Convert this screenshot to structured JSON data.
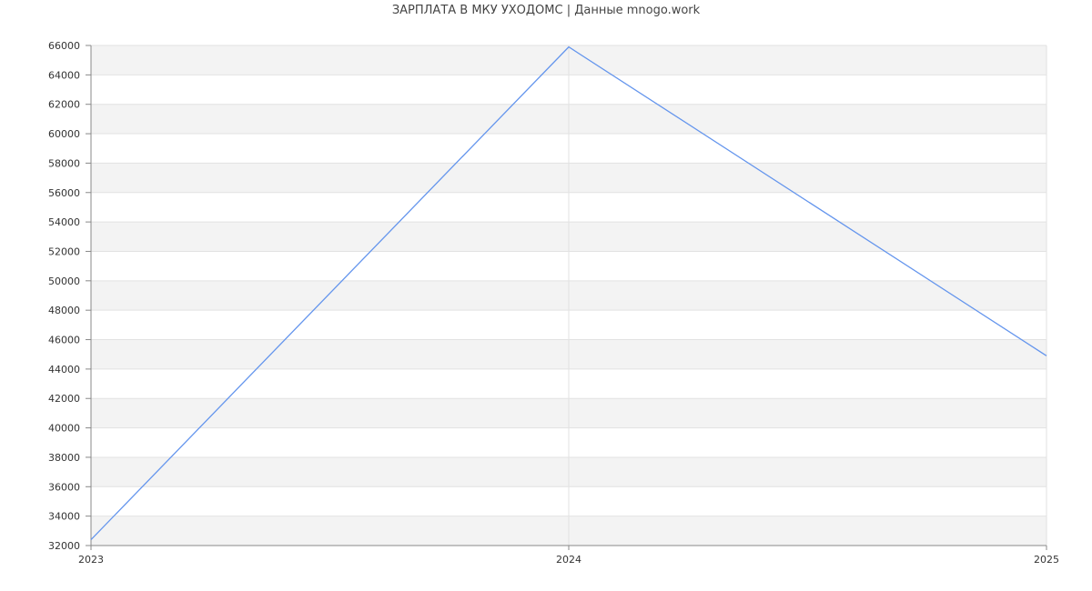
{
  "chart_data": {
    "type": "line",
    "title": "ЗАРПЛАТА В МКУ УХОДОМС | Данные mnogo.work",
    "xlabel": "",
    "ylabel": "",
    "x": [
      "2023",
      "2024",
      "2025"
    ],
    "series": [
      {
        "values": [
          32400,
          65900,
          44900
        ]
      }
    ],
    "ylim": [
      32000,
      66000
    ],
    "y_ticks": [
      32000,
      34000,
      36000,
      38000,
      40000,
      42000,
      44000,
      46000,
      48000,
      50000,
      52000,
      54000,
      56000,
      58000,
      60000,
      62000,
      64000,
      66000
    ],
    "grid": true,
    "legend": "none",
    "colors": {
      "line": "#6495ed",
      "band": "#f3f3f3",
      "grid": "#e2e2e2",
      "axis": "#888888"
    }
  }
}
